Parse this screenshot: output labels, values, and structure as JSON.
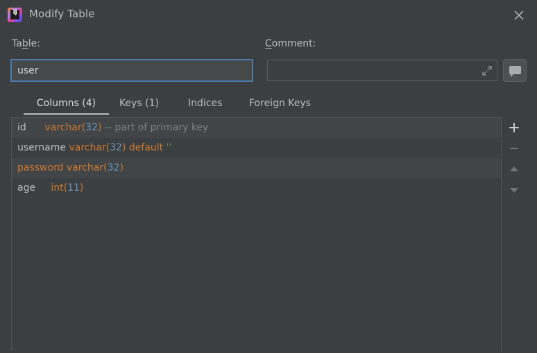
{
  "window": {
    "title": "Modify Table",
    "app_icon": "intellij-idea-logo",
    "close_label": "×"
  },
  "form": {
    "table_label_prefix": "Ta",
    "table_label_mnemonic": "b",
    "table_label_suffix": "le:",
    "table_label_full": "Table:",
    "table_value": "user",
    "table_placeholder": "",
    "comment_label_mnemonic": "C",
    "comment_label_suffix": "omment:",
    "comment_label_full": "Comment:",
    "comment_value": "",
    "comment_placeholder": "",
    "expand_icon": "expand-diagonal-icon",
    "comment_button_icon": "speech-bubble-icon"
  },
  "tabs": [
    {
      "label": "Columns (4)",
      "active": true
    },
    {
      "label": "Keys (1)",
      "active": false
    },
    {
      "label": "Indices",
      "active": false
    },
    {
      "label": "Foreign Keys",
      "active": false
    }
  ],
  "columns": [
    {
      "alt": true,
      "segments": [
        {
          "text": "id",
          "kind": "name"
        },
        {
          "text": "      ",
          "kind": "name"
        },
        {
          "text": "varchar",
          "kind": "type"
        },
        {
          "text": "(",
          "kind": "paren"
        },
        {
          "text": "32",
          "kind": "number"
        },
        {
          "text": ")",
          "kind": "paren"
        },
        {
          "text": " ",
          "kind": "name"
        },
        {
          "text": "-- part of primary key",
          "kind": "comment"
        }
      ]
    },
    {
      "alt": false,
      "segments": [
        {
          "text": "username",
          "kind": "name"
        },
        {
          "text": " ",
          "kind": "name"
        },
        {
          "text": "varchar",
          "kind": "type"
        },
        {
          "text": "(",
          "kind": "paren"
        },
        {
          "text": "32",
          "kind": "number"
        },
        {
          "text": ")",
          "kind": "paren"
        },
        {
          "text": " ",
          "kind": "name"
        },
        {
          "text": "default",
          "kind": "keyword"
        },
        {
          "text": " ",
          "kind": "name"
        },
        {
          "text": "''",
          "kind": "string"
        }
      ]
    },
    {
      "alt": true,
      "segments": [
        {
          "text": "password",
          "kind": "keyword"
        },
        {
          "text": " ",
          "kind": "name"
        },
        {
          "text": "varchar",
          "kind": "type"
        },
        {
          "text": "(",
          "kind": "paren"
        },
        {
          "text": "32",
          "kind": "number"
        },
        {
          "text": ")",
          "kind": "paren"
        }
      ]
    },
    {
      "alt": false,
      "segments": [
        {
          "text": "age",
          "kind": "name"
        },
        {
          "text": "     ",
          "kind": "name"
        },
        {
          "text": "int",
          "kind": "type"
        },
        {
          "text": "(",
          "kind": "paren"
        },
        {
          "text": "11",
          "kind": "number"
        },
        {
          "text": ")",
          "kind": "paren"
        }
      ]
    }
  ],
  "toolbar": [
    {
      "icon": "plus-icon",
      "name": "add-column-button",
      "enabled": true
    },
    {
      "icon": "minus-icon",
      "name": "remove-column-button",
      "enabled": false
    },
    {
      "icon": "arrow-up-icon",
      "name": "move-column-up-button",
      "enabled": false
    },
    {
      "icon": "arrow-down-icon",
      "name": "move-column-down-button",
      "enabled": false
    }
  ],
  "colors": {
    "background": "#3c3f41",
    "row_alt": "#414547",
    "focus_border": "#4d7cad",
    "keyword": "#cc7832",
    "number": "#6897bb",
    "comment": "#808080",
    "string": "#6a8759",
    "text": "#bbbbbb"
  }
}
